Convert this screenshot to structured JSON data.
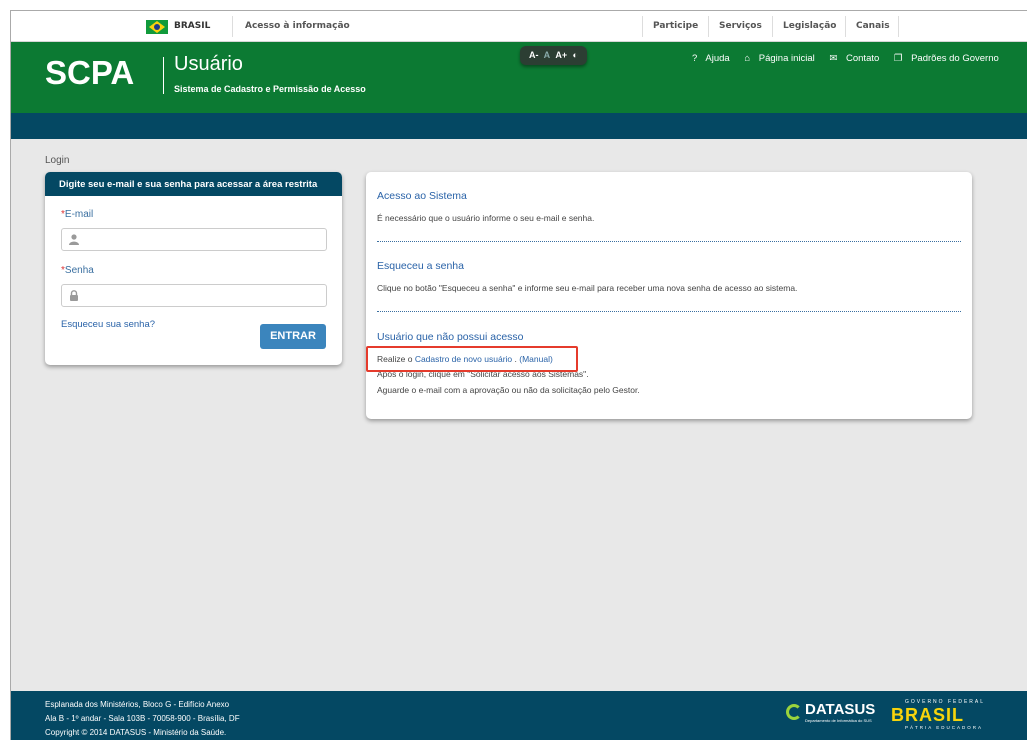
{
  "govbar": {
    "country": "BRASIL",
    "access_info": "Acesso à informação",
    "links": [
      "Participe",
      "Serviços",
      "Legislação",
      "Canais"
    ]
  },
  "header": {
    "logo": "SCPA",
    "title": "Usuário",
    "subtitle": "Sistema de Cadastro e Permissão de Acesso",
    "font_controls": {
      "decrease": "A-",
      "default": "A",
      "increase": "A+",
      "contrast": "◐"
    },
    "links": {
      "help": "Ajuda",
      "home": "Página inicial",
      "contact": "Contato",
      "standards": "Padrões do Governo"
    }
  },
  "breadcrumb": "Login",
  "login": {
    "panel_title": "Digite seu e-mail e sua senha para acessar a área restrita",
    "email_label": "E-mail",
    "email_value": "",
    "password_label": "Senha",
    "password_value": "",
    "required_mark": "*",
    "forgot_link": "Esqueceu sua senha?",
    "submit_label": "ENTRAR"
  },
  "info": {
    "s1_title": "Acesso ao Sistema",
    "s1_text": "É necessário que o usuário informe o seu e-mail e senha.",
    "s2_title": "Esqueceu a senha",
    "s2_text": "Clique no botão \"Esqueceu a senha\" e informe seu e-mail para receber uma nova senha de acesso ao sistema.",
    "s3_title": "Usuário que não possui acesso",
    "s3_prefix": "Realize o",
    "s3_link": "Cadastro de novo usuário",
    "s3_dot": " .",
    "s3_manual": "(Manual)",
    "s3_line2": "Após o login, clique em \"Solicitar acesso aos Sistemas\".",
    "s3_line3": "Aguarde o e-mail com a aprovação ou não da solicitação pelo Gestor."
  },
  "footer": {
    "line1": "Esplanada dos Ministérios, Bloco G - Edifício Anexo",
    "line2": "Ala B - 1º andar - Sala 103B - 70058-900 - Brasília, DF",
    "line3": "Copyright © 2014 DATASUS - Ministério da Saúde.",
    "datasus": "DATASUS",
    "datasus_sub": "Departamento de Informática do SUS",
    "gov_top": "GOVERNO FEDERAL",
    "gov_main": "BRASIL",
    "gov_bottom": "PÁTRIA EDUCADORA"
  },
  "colors": {
    "green": "#0c7a33",
    "navy": "#044863",
    "link": "#2a63a8",
    "highlight": "#e53b2c"
  }
}
